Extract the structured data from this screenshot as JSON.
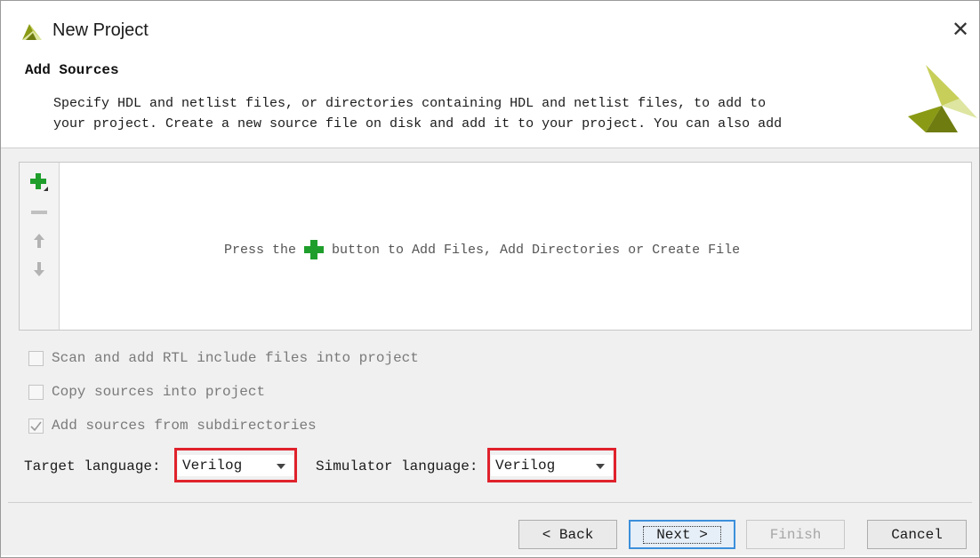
{
  "window": {
    "title": "New Project",
    "close_glyph": "✕"
  },
  "header": {
    "title": "Add Sources",
    "description_lines": [
      "Specify HDL and netlist files, or directories containing HDL and netlist files, to add to",
      "your project. Create a new source file on disk and add it to your project. You can also add"
    ]
  },
  "toolbar": {
    "add_icon": "plus-icon",
    "remove_icon": "minus-icon",
    "move_up_icon": "arrow-up-icon",
    "move_down_icon": "arrow-down-icon"
  },
  "sources": {
    "empty_before": "Press the",
    "empty_after": "button to Add Files, Add Directories or Create File"
  },
  "options": {
    "scan_rtl": {
      "label": "Scan and add RTL include files into project",
      "checked": false
    },
    "copy_sources": {
      "label": "Copy sources into project",
      "checked": false
    },
    "subdirectories": {
      "label": "Add sources from subdirectories",
      "checked": true
    }
  },
  "language": {
    "target_label": "Target language:",
    "target_value": "Verilog",
    "simulator_label": "Simulator language:",
    "simulator_value": "Verilog"
  },
  "buttons": {
    "back": "< Back",
    "next": "Next >",
    "finish": "Finish",
    "cancel": "Cancel"
  },
  "colors": {
    "accent_green": "#1f9e2c",
    "highlight_red": "#e0222c",
    "focus_blue": "#3c8fdb",
    "logo_olive": "#8a9a14",
    "logo_light": "#dde5a0"
  }
}
